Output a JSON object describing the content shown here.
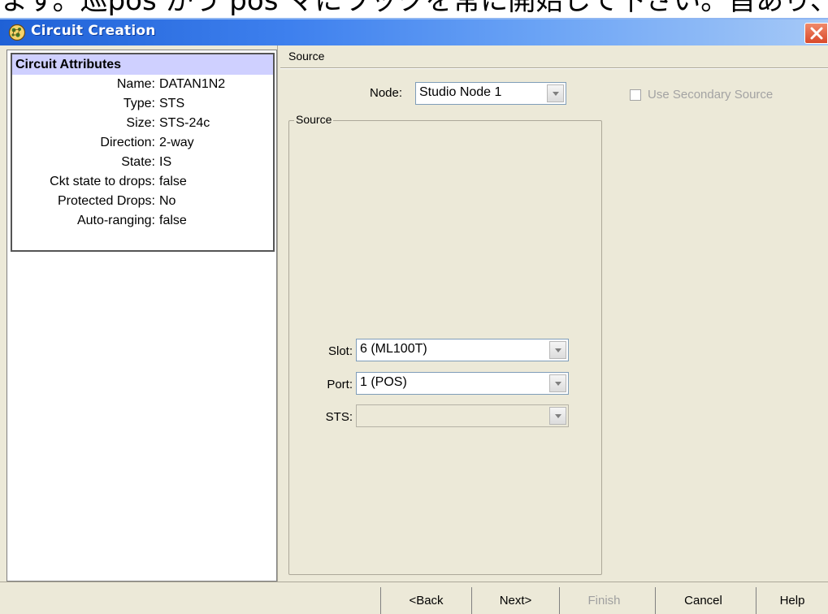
{
  "window": {
    "title": "Circuit Creation",
    "cropped_heading": "ます。巡pos かう pos マにワックを常に開始して下さい。旨あり、す"
  },
  "left_panel": {
    "header": "Circuit Attributes",
    "attributes": [
      {
        "key": "Name:",
        "value": "DATAN1N2"
      },
      {
        "key": "Type:",
        "value": "STS"
      },
      {
        "key": "Size:",
        "value": "STS-24c"
      },
      {
        "key": "Direction:",
        "value": "2-way"
      },
      {
        "key": "State:",
        "value": "IS"
      },
      {
        "key": "Ckt state to drops:",
        "value": "false"
      },
      {
        "key": "Protected Drops:",
        "value": "No"
      },
      {
        "key": "Auto-ranging:",
        "value": "false"
      }
    ]
  },
  "right_panel": {
    "section_title": "Source",
    "node_label": "Node:",
    "node_value": "Studio Node 1",
    "use_secondary_label": "Use Secondary Source",
    "group_title": "Source",
    "slot_label": "Slot:",
    "slot_value": "6 (ML100T)",
    "port_label": "Port:",
    "port_value": "1 (POS)",
    "sts_label": "STS:",
    "sts_value": ""
  },
  "buttons": {
    "back": "<Back",
    "next": "Next>",
    "finish": "Finish",
    "cancel": "Cancel",
    "help": "Help"
  },
  "icons": {
    "app": "network-globe-icon",
    "close": "close-icon",
    "dropdown": "chevron-down-icon"
  },
  "colors": {
    "titlebar": "#3e80ee",
    "close": "#d9492a",
    "attr_header": "#cfd0ff",
    "dialog_bg": "#ece9d8"
  }
}
